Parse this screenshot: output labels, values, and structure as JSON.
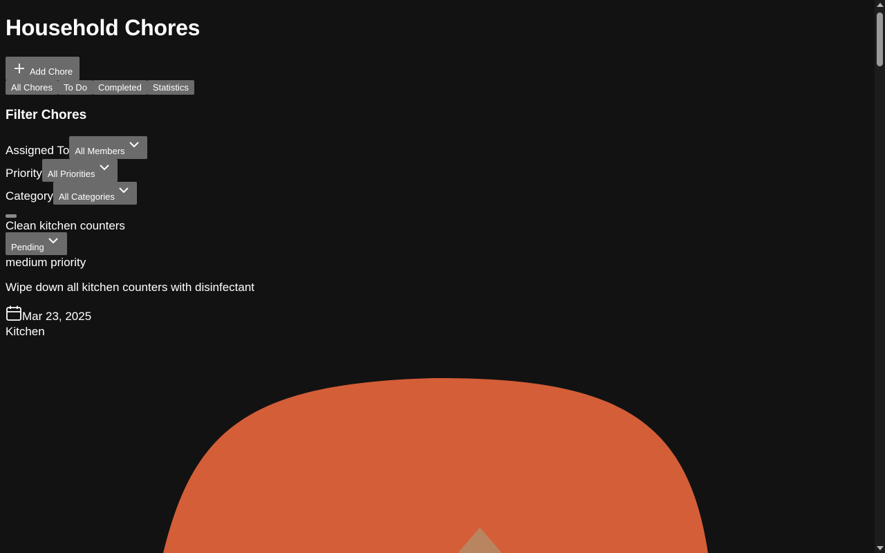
{
  "header": {
    "title": "Household Chores"
  },
  "toolbar": {
    "add_label": "Add Chore"
  },
  "tabs": [
    {
      "label": "All Chores"
    },
    {
      "label": "To Do"
    },
    {
      "label": "Completed"
    },
    {
      "label": "Statistics"
    }
  ],
  "filters": {
    "title": "Filter Chores",
    "assigned": {
      "label": "Assigned To",
      "value": "All Members"
    },
    "priority": {
      "label": "Priority",
      "value": "All Priorities"
    },
    "category": {
      "label": "Category",
      "value": "All Categories"
    }
  },
  "chore": {
    "title": "Clean kitchen counters",
    "status": "Pending",
    "priority": "medium priority",
    "description": "Wipe down all kitchen counters with disinfectant",
    "date": "Mar 23, 2025",
    "category": "Kitchen"
  },
  "colors": {
    "background": "#121212",
    "button": "#6b6b6b",
    "blob": "#d45e37",
    "blob_accent": "#b98561"
  },
  "icons": {
    "add": "plus-icon",
    "select": "chevron-down-icon",
    "date": "calendar-icon"
  }
}
